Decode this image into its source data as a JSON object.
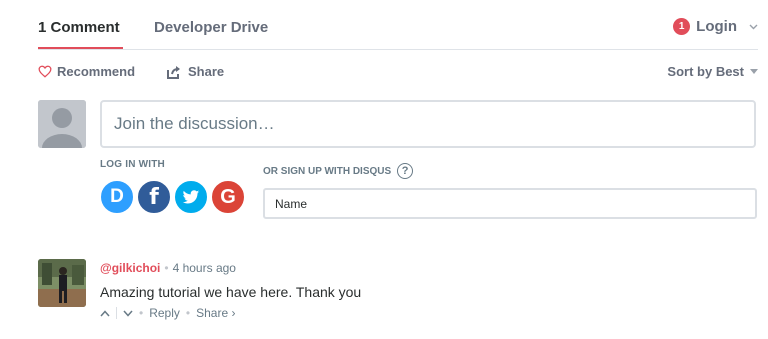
{
  "nav": {
    "comment_count": "1 Comment",
    "forum_name": "Developer Drive",
    "notification_count": "1",
    "login_label": "Login",
    "caret": "⌄"
  },
  "actions": {
    "recommend_label": "Recommend",
    "share_label": "Share",
    "sort_label": "Sort by Best"
  },
  "composer": {
    "placeholder": "Join the discussion…",
    "login_with_label": "LOG IN WITH",
    "signup_label": "OR SIGN UP WITH DISQUS",
    "help_glyph": "?",
    "name_placeholder": "Name",
    "social": {
      "disqus": "D",
      "facebook": "f",
      "twitter": "t",
      "google": "G"
    }
  },
  "comment": {
    "author": "@gilkichoi",
    "separator": "•",
    "time": "4 hours ago",
    "body": "Amazing tutorial we have here. Thank you",
    "upvote_glyph": "^",
    "downvote_glyph": "⌄",
    "reply_label": "Reply",
    "share_label": "Share ›"
  },
  "colors": {
    "accent": "#e14d5a",
    "muted_text": "#656c7a",
    "border": "#dbdfe4",
    "disqus_blue": "#2e9fff",
    "facebook_blue": "#305c99",
    "twitter_blue": "#00aced",
    "google_red": "#db4437"
  }
}
